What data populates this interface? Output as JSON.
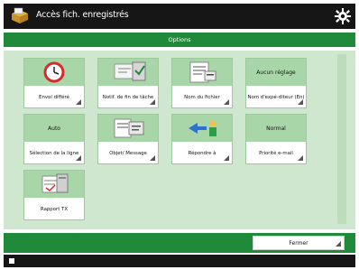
{
  "window": {
    "title": "Accès fich. enregistrés"
  },
  "tabs": {
    "active_label": "Options"
  },
  "tiles": [
    {
      "head": "",
      "label": "Envoi différé",
      "icon": "clock-icon"
    },
    {
      "head": "",
      "label": "Notif. de fin de tâche",
      "icon": "notification-icon"
    },
    {
      "head": "",
      "label": "Nom du fichier",
      "icon": "file-name-icon"
    },
    {
      "head": "Aucun réglage",
      "label": "Nom d'expé-diteur (En)",
      "icon": ""
    },
    {
      "head": "Auto",
      "label": "Sélection de la ligne",
      "icon": ""
    },
    {
      "head": "",
      "label": "Objet/ Message",
      "icon": "subject-message-icon"
    },
    {
      "head": "",
      "label": "Répondre à",
      "icon": "reply-to-icon"
    },
    {
      "head": "Normal",
      "label": "Priorité e-mail",
      "icon": ""
    },
    {
      "head": "",
      "label": "Rapport TX",
      "icon": "tx-report-icon"
    }
  ],
  "footer": {
    "close_label": "Fermer"
  }
}
